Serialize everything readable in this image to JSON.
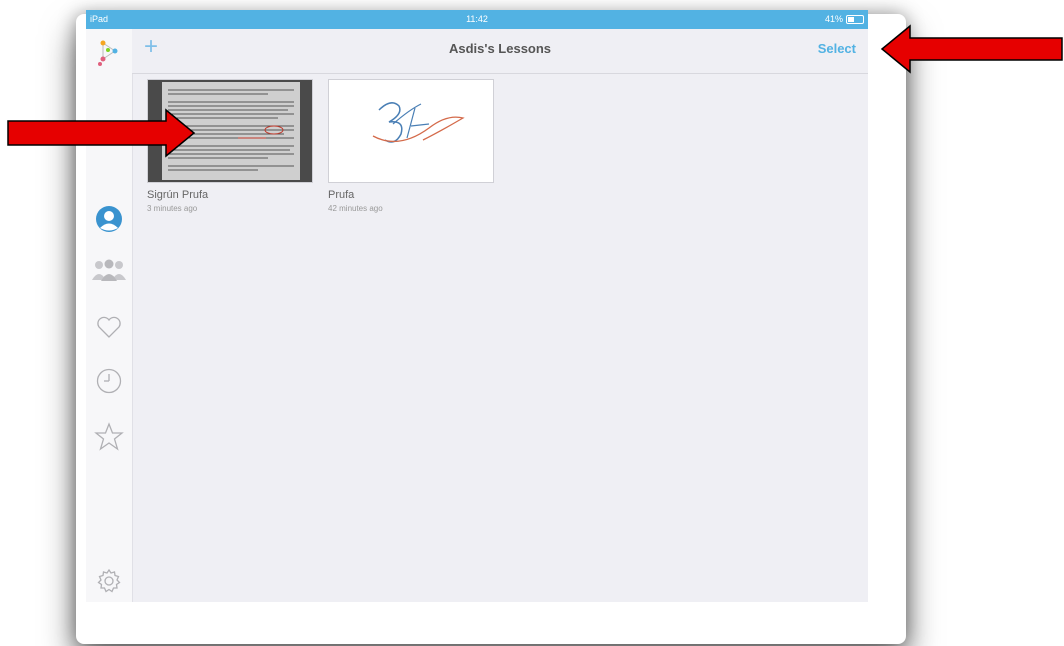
{
  "status_bar": {
    "device": "iPad",
    "time": "11:42",
    "battery": "41%"
  },
  "nav": {
    "add_label": "+",
    "title": "Asdis's Lessons",
    "select_label": "Select"
  },
  "lessons": [
    {
      "title": "Sigrún Prufa",
      "time": "3 minutes ago"
    },
    {
      "title": "Prufa",
      "time": "42 minutes ago"
    }
  ],
  "sidebar": {
    "items": [
      "logo-icon",
      "profile-icon",
      "groups-icon",
      "heart-icon",
      "clock-icon",
      "star-icon",
      "settings-icon"
    ]
  },
  "colors": {
    "accent": "#52b2e3",
    "arrow": "#e60000",
    "profile_active": "#3a93cf"
  }
}
